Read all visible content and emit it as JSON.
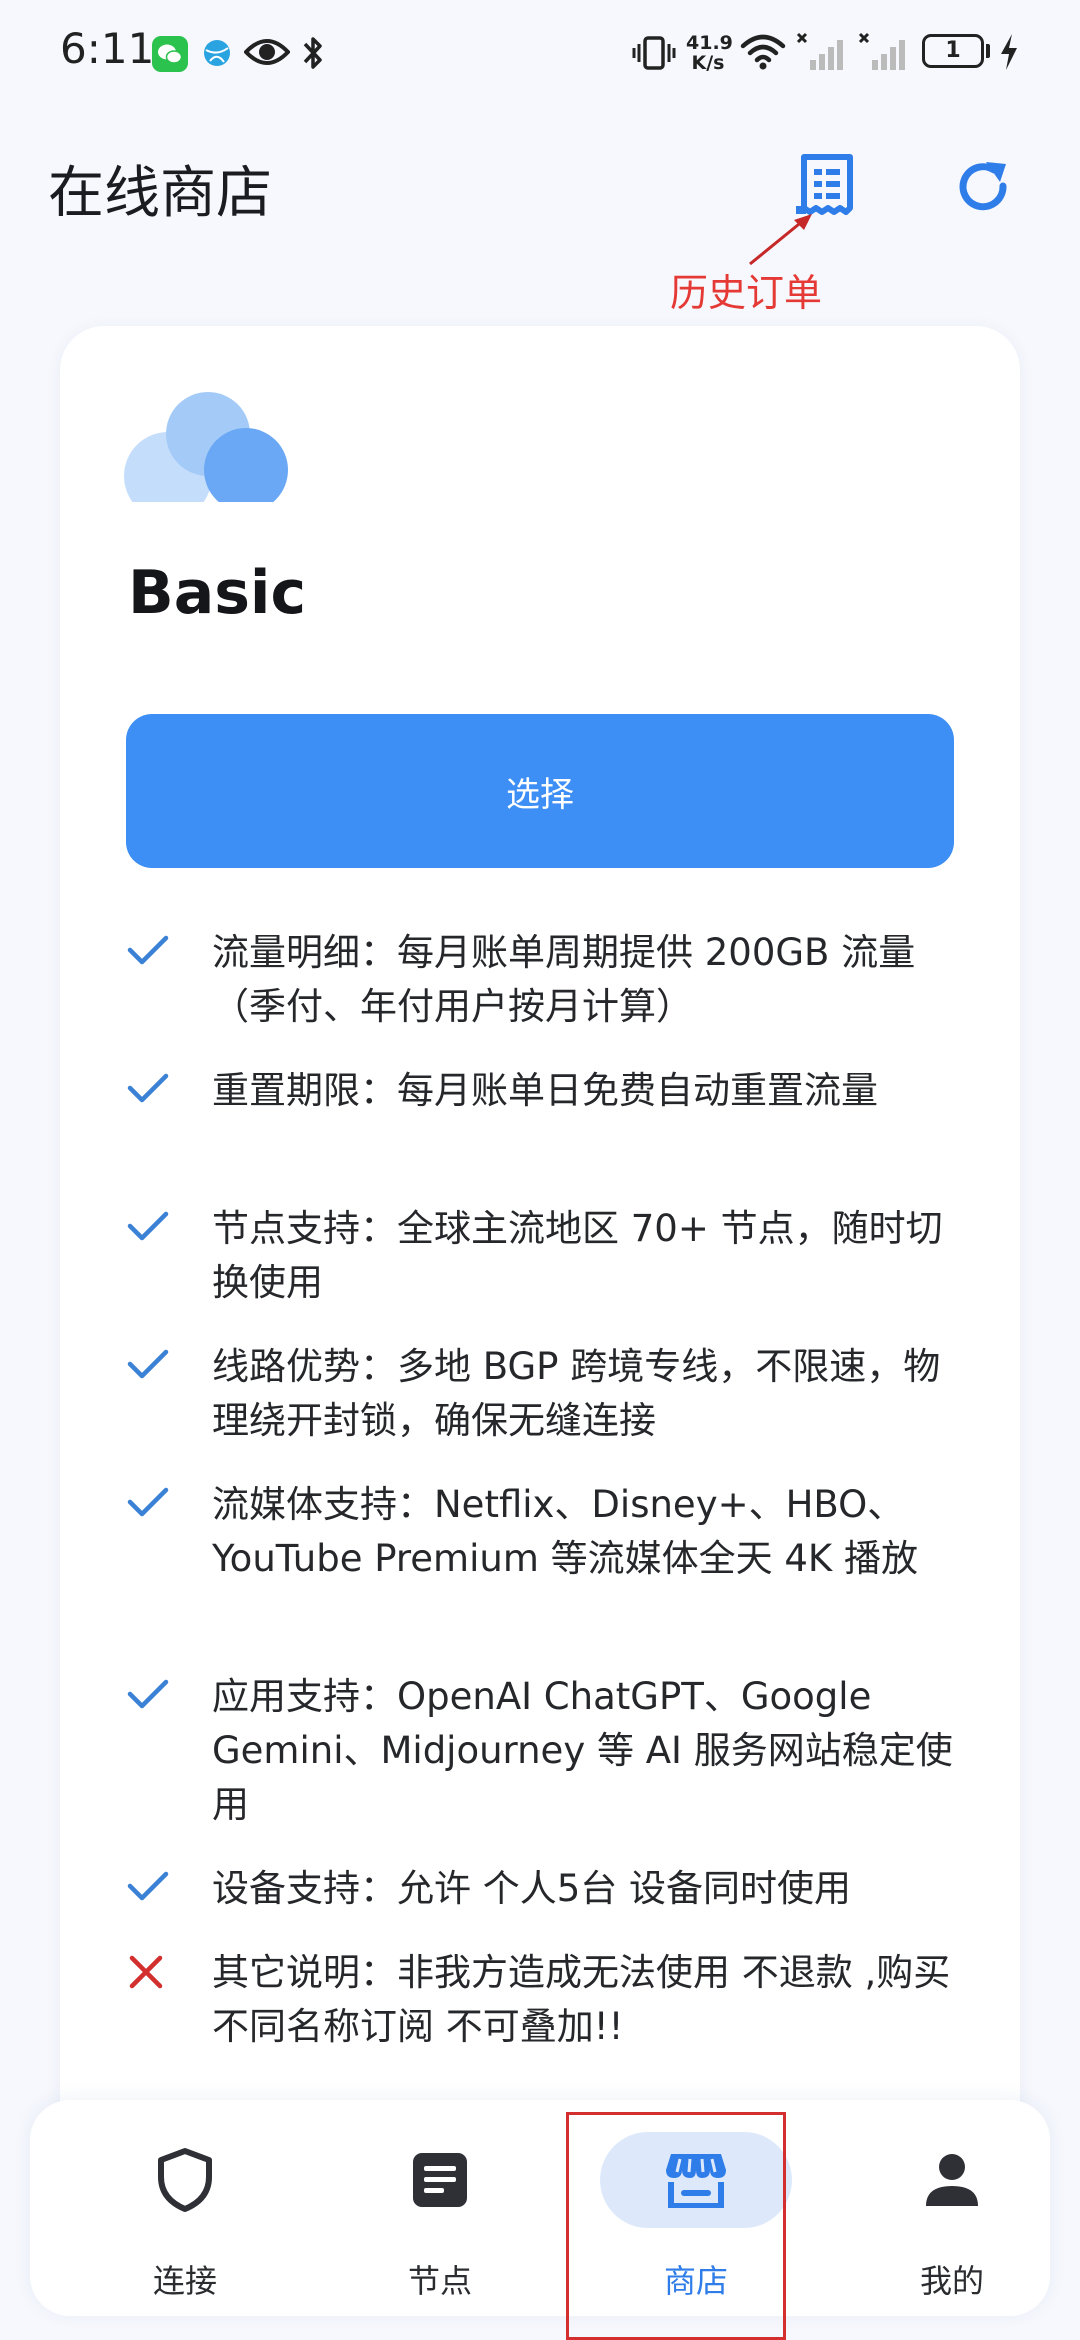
{
  "status_bar": {
    "time": "6:11",
    "net_speed_value": "41.9",
    "net_speed_unit": "K/s",
    "battery_level": "1"
  },
  "header": {
    "title": "在线商店",
    "history_orders_annotation": "历史订单"
  },
  "plan": {
    "name": "Basic",
    "select_label": "选择",
    "features": [
      {
        "status": "included",
        "text": "流量明细：每月账单周期提供 200GB 流量（季付、年付用户按月计算）"
      },
      {
        "status": "included",
        "text": "重置期限：每月账单日免费自动重置流量"
      },
      {
        "status": "included",
        "text": "节点支持：全球主流地区 70+ 节点，随时切换使用"
      },
      {
        "status": "included",
        "text": "线路优势：多地 BGP 跨境专线，不限速，物理绕开封锁，确保无缝连接"
      },
      {
        "status": "included",
        "text": "流媒体支持：Netflix、Disney+、HBO、YouTube Premium 等流媒体全天 4K 播放"
      },
      {
        "status": "included",
        "text": "应用支持：OpenAI ChatGPT、Google Gemini、Midjourney 等 AI 服务网站稳定使用"
      },
      {
        "status": "included",
        "text": "设备支持：允许 个人5台 设备同时使用"
      },
      {
        "status": "excluded",
        "text": "其它说明：非我方造成无法使用 不退款 ,购买不同名称订阅 不可叠加!!"
      }
    ]
  },
  "bottom_nav": {
    "items": [
      {
        "label": "连接",
        "icon": "shield-icon"
      },
      {
        "label": "节点",
        "icon": "list-icon"
      },
      {
        "label": "商店",
        "icon": "store-icon"
      },
      {
        "label": "我的",
        "icon": "person-icon"
      }
    ],
    "active_index": 2
  },
  "colors": {
    "accent": "#3d8ef5",
    "check": "#3b82d6",
    "cross": "#d32f2f",
    "annotation": "#e53935"
  }
}
